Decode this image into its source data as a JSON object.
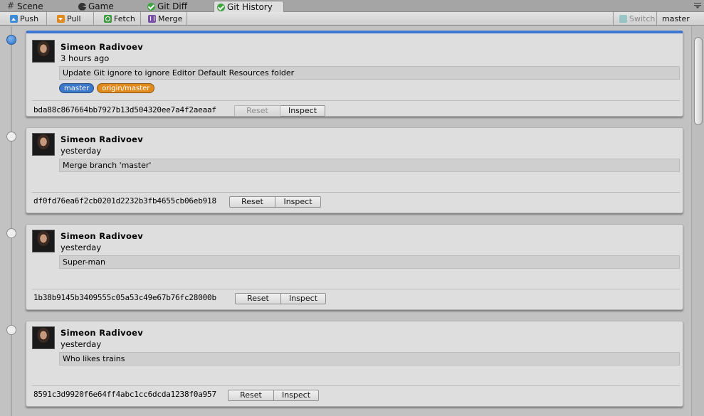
{
  "tabs": [
    {
      "label": "Scene",
      "icon": "hash-icon"
    },
    {
      "label": "Game",
      "icon": "pacman-icon"
    },
    {
      "label": "Git Diff",
      "icon": "check-icon"
    },
    {
      "label": "Git History",
      "icon": "check-icon",
      "active": true
    }
  ],
  "toolbar": {
    "push_label": "Push",
    "pull_label": "Pull",
    "fetch_label": "Fetch",
    "merge_label": "Merge",
    "switch_label": "Switch",
    "branch": "master"
  },
  "commits": [
    {
      "author": "Simeon Radivoev",
      "time": "3 hours ago",
      "message": "Update Git ignore to ignore Editor Default Resources folder",
      "tags": [
        "master",
        "origin/master"
      ],
      "hash": "bda88c867664bb7927b13d504320ee7a4f2aeaaf",
      "reset_label": "Reset",
      "inspect_label": "Inspect",
      "reset_disabled": true,
      "selected": true
    },
    {
      "author": "Simeon Radivoev",
      "time": "yesterday",
      "message": "Merge branch 'master'",
      "hash": "df0fd76ea6f2cb0201d2232b3fb4655cb06eb918",
      "reset_label": "Reset",
      "inspect_label": "Inspect"
    },
    {
      "author": "Simeon Radivoev",
      "time": "yesterday",
      "message": "Super-man",
      "hash": "1b38b9145b3409555c05a53c49e67b76fc28000b",
      "reset_label": "Reset",
      "inspect_label": "Inspect"
    },
    {
      "author": "Simeon Radivoev",
      "time": "yesterday",
      "message": "Who likes trains",
      "hash": "8591c3d9920f6e64ff4abc1cc6dcda1238f0a957",
      "reset_label": "Reset",
      "inspect_label": "Inspect"
    }
  ],
  "colors": {
    "selected_accent": "#3d78d0",
    "tag_master": "#3b78c9",
    "tag_origin": "#e08a1e"
  }
}
